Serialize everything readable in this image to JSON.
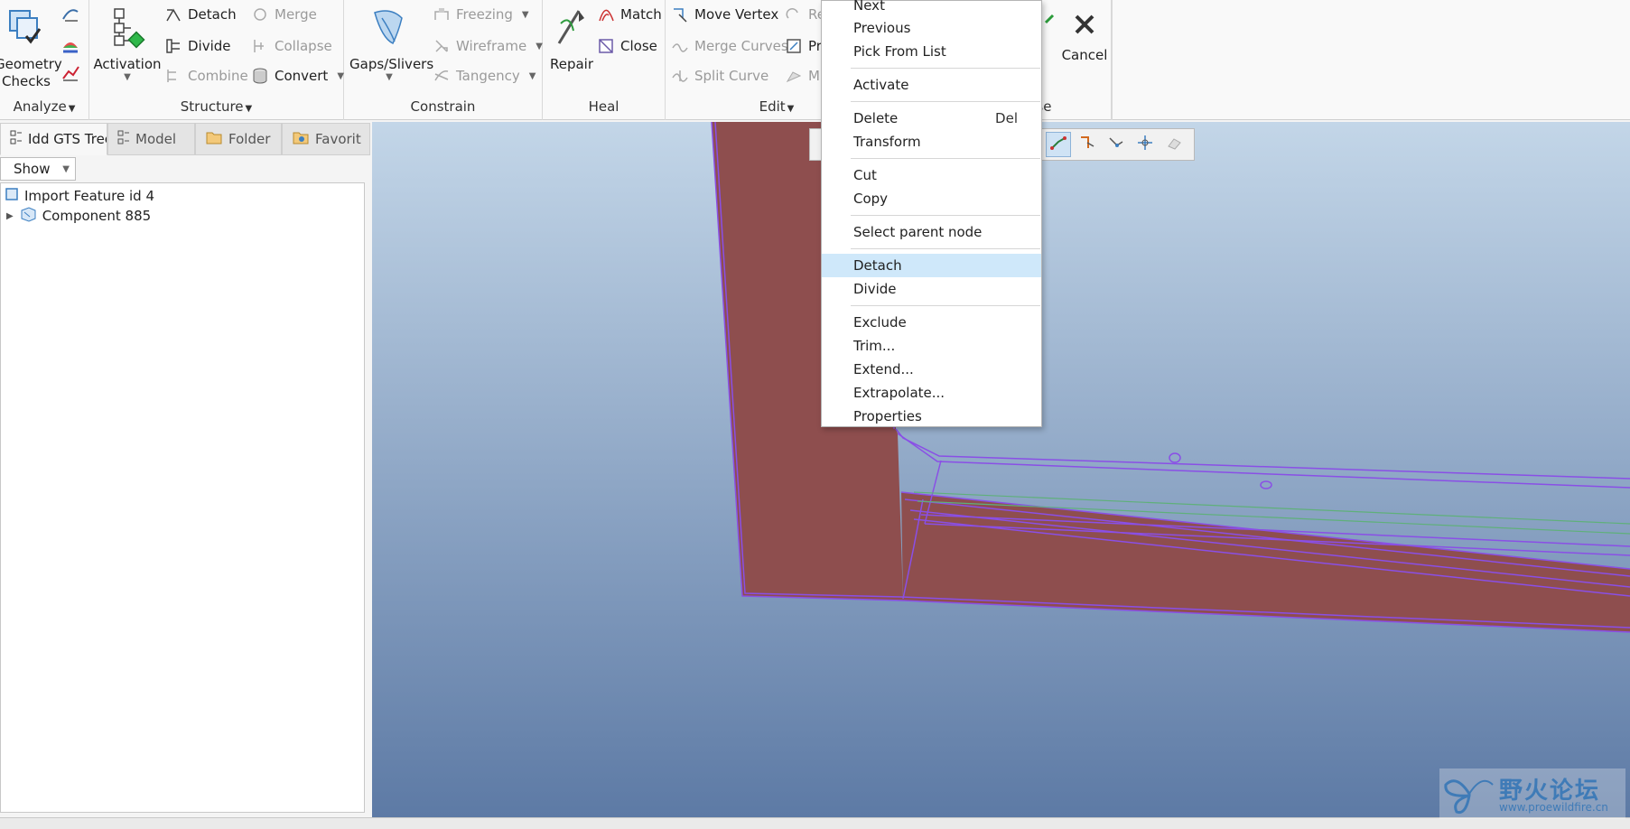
{
  "ribbon": {
    "analyze": {
      "label": "Analyze",
      "geometry_checks": "Geometry\nChecks"
    },
    "structure": {
      "label": "Structure",
      "activation": "Activation",
      "detach": "Detach",
      "divide": "Divide",
      "combine": "Combine",
      "merge": "Merge",
      "collapse": "Collapse",
      "convert": "Convert"
    },
    "constrain": {
      "label": "Constrain",
      "gaps_slivers": "Gaps/Slivers",
      "freezing": "Freezing",
      "wireframe": "Wireframe",
      "tangency": "Tangency"
    },
    "heal": {
      "label": "Heal",
      "repair": "Repair",
      "match": "Match",
      "close": "Close"
    },
    "edit": {
      "label": "Edit",
      "move_vertex": "Move Vertex",
      "merge_curves": "Merge Curves",
      "split_curve": "Split Curve",
      "partial_re": "Re",
      "partial_pr": "Pr",
      "partial_m": "M"
    },
    "close_group": {
      "label": "Close",
      "cancel": "Cancel"
    }
  },
  "left_panel": {
    "tabs": [
      {
        "label": "Idd GTS Tree"
      },
      {
        "label": "Model"
      },
      {
        "label": "Folder"
      },
      {
        "label": "Favorit"
      }
    ],
    "show": "Show",
    "tree": [
      {
        "label": "Import Feature id 4"
      },
      {
        "label": "Component 885"
      }
    ]
  },
  "context_menu": {
    "items": [
      {
        "label": "Next"
      },
      {
        "label": "Previous"
      },
      {
        "label": "Pick From List"
      },
      {
        "label": "Activate"
      },
      {
        "label": "Delete",
        "shortcut": "Del"
      },
      {
        "label": "Transform"
      },
      {
        "label": "Cut"
      },
      {
        "label": "Copy"
      },
      {
        "label": "Select parent node"
      },
      {
        "label": "Detach"
      },
      {
        "label": "Divide"
      },
      {
        "label": "Exclude"
      },
      {
        "label": "Trim..."
      },
      {
        "label": "Extend..."
      },
      {
        "label": "Extrapolate..."
      },
      {
        "label": "Properties"
      }
    ],
    "highlighted": "Detach"
  },
  "watermark": {
    "title": "野火论坛",
    "url": "www.proewildfire.cn"
  },
  "colors": {
    "model_surface": "#8e4e4e",
    "edge_lines": "#8a4fe6",
    "menu_highlight": "#cfe8fa",
    "viewport_top": "#c3d6e8",
    "viewport_bottom": "#5d7aa5"
  }
}
